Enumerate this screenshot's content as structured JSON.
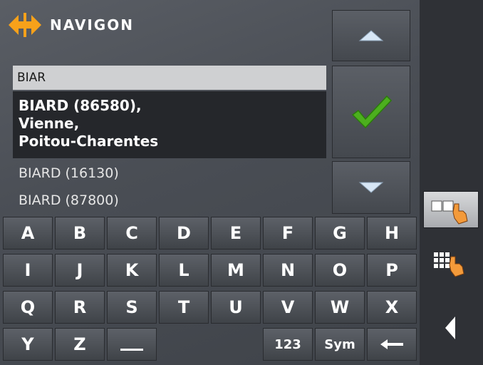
{
  "app": {
    "brand": "NAVIGON"
  },
  "search": {
    "input_value": "BIAR"
  },
  "results": {
    "selected": {
      "line1": "BIARD (86580),",
      "line2": "Vienne,",
      "line3": "Poitou-Charentes"
    },
    "items": [
      {
        "label": "BIARD (16130)"
      },
      {
        "label": "BIARD (87800)"
      }
    ]
  },
  "keyboard": {
    "row1": [
      "A",
      "B",
      "C",
      "D",
      "E",
      "F",
      "G",
      "H"
    ],
    "row2": [
      "I",
      "J",
      "K",
      "L",
      "M",
      "N",
      "O",
      "P"
    ],
    "row3": [
      "Q",
      "R",
      "S",
      "T",
      "U",
      "V",
      "W",
      "X"
    ],
    "row4": {
      "y": "Y",
      "z": "Z",
      "numbers": "123",
      "symbols": "Sym"
    }
  },
  "icons": {
    "logo": "navigon-arrows-logo",
    "up": "triangle-up-icon",
    "down": "triangle-down-icon",
    "ok": "checkmark-icon",
    "abc_mode": "abc-keyboard-hand-icon",
    "grid_mode": "grid-keyboard-hand-icon",
    "back": "triangle-left-icon",
    "space": "space-bar-icon",
    "backspace": "backspace-arrow-icon"
  },
  "colors": {
    "accent": "#f7a11a",
    "check": "#4caf1e"
  }
}
